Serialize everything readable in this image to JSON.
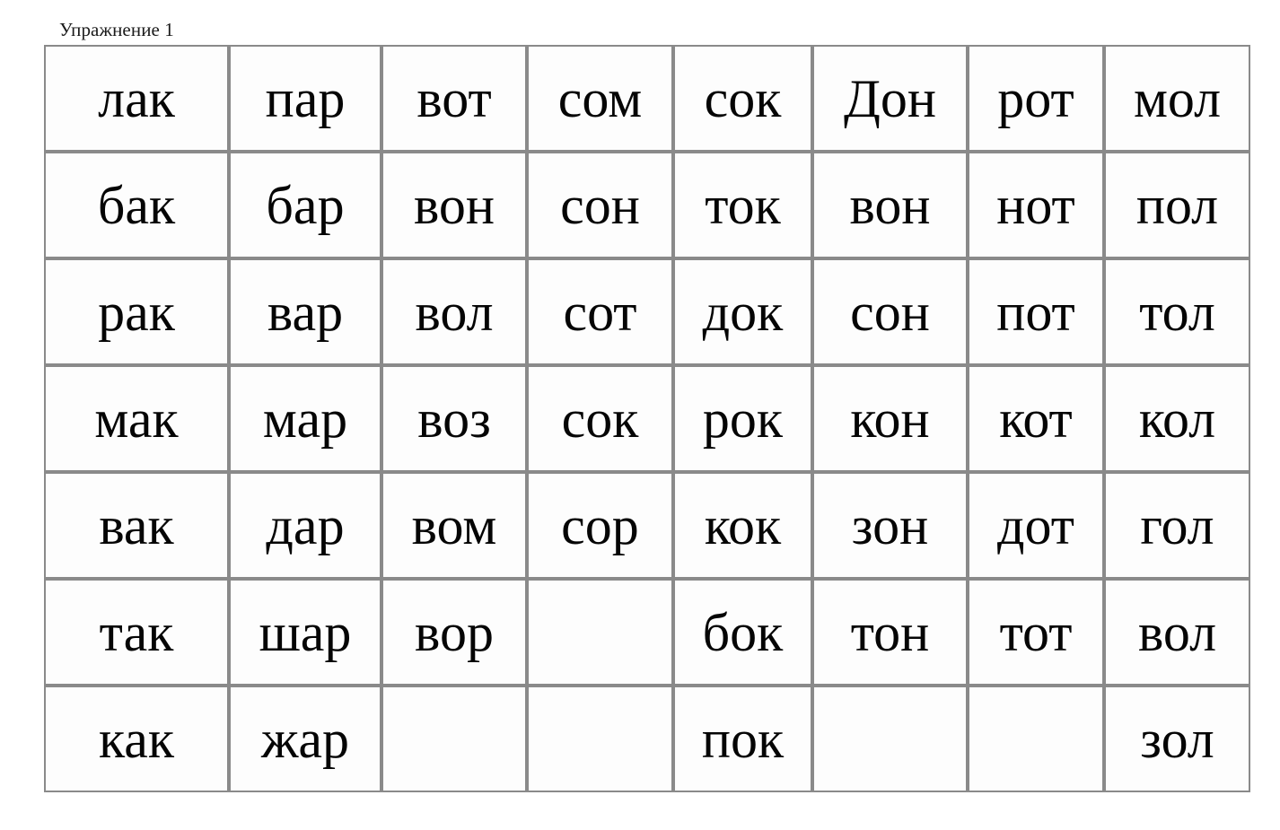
{
  "document": {
    "title": "Упражнение 1",
    "background_color": "#ffffff",
    "text_color": "#050505",
    "grid_border_color": "#8a8a8a"
  },
  "grid": {
    "rows": 7,
    "columns": 8,
    "cells": [
      [
        "лак",
        "пар",
        "вот",
        "сом",
        "сок",
        "Дон",
        "рот",
        "мол"
      ],
      [
        "бак",
        "бар",
        "вон",
        "сон",
        "ток",
        "вон",
        "нот",
        "пол"
      ],
      [
        "рак",
        "вар",
        "вол",
        "сот",
        "док",
        "сон",
        "пот",
        "тол"
      ],
      [
        "мак",
        "мар",
        "воз",
        "сок",
        "рок",
        "кон",
        "кот",
        "кол"
      ],
      [
        "вак",
        "дар",
        "вом",
        "сор",
        "кок",
        "зон",
        "дот",
        "гол"
      ],
      [
        "так",
        "шар",
        "вор",
        "",
        "бок",
        "тон",
        "тот",
        "вол"
      ],
      [
        "как",
        "жар",
        "",
        "",
        "пок",
        "",
        "",
        "зол"
      ]
    ]
  }
}
